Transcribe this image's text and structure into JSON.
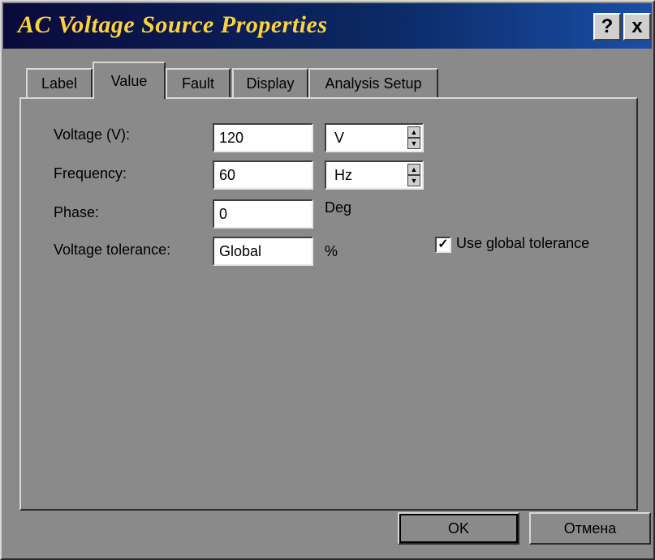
{
  "window": {
    "title": "AC Voltage Source Properties",
    "help_label": "?",
    "close_label": "x"
  },
  "tabs": [
    {
      "label": "Label"
    },
    {
      "label": "Value"
    },
    {
      "label": "Fault"
    },
    {
      "label": "Display"
    },
    {
      "label": "Analysis Setup"
    }
  ],
  "active_tab": "Value",
  "fields": {
    "voltage": {
      "label": "Voltage (V):",
      "value": "120",
      "unit": "V"
    },
    "frequency": {
      "label": "Frequency:",
      "value": "60",
      "unit": "Hz"
    },
    "phase": {
      "label": "Phase:",
      "value": "0",
      "unit": "Deg"
    },
    "tolerance": {
      "label": "Voltage tolerance:",
      "value": "Global",
      "unit": "%"
    }
  },
  "global_tolerance": {
    "label": "Use global tolerance",
    "checked": true
  },
  "buttons": {
    "ok": "OK",
    "cancel": "Отмена"
  },
  "icons": {
    "spin_up": "spin-up-icon",
    "spin_down": "spin-down-icon",
    "check": "check-icon"
  }
}
